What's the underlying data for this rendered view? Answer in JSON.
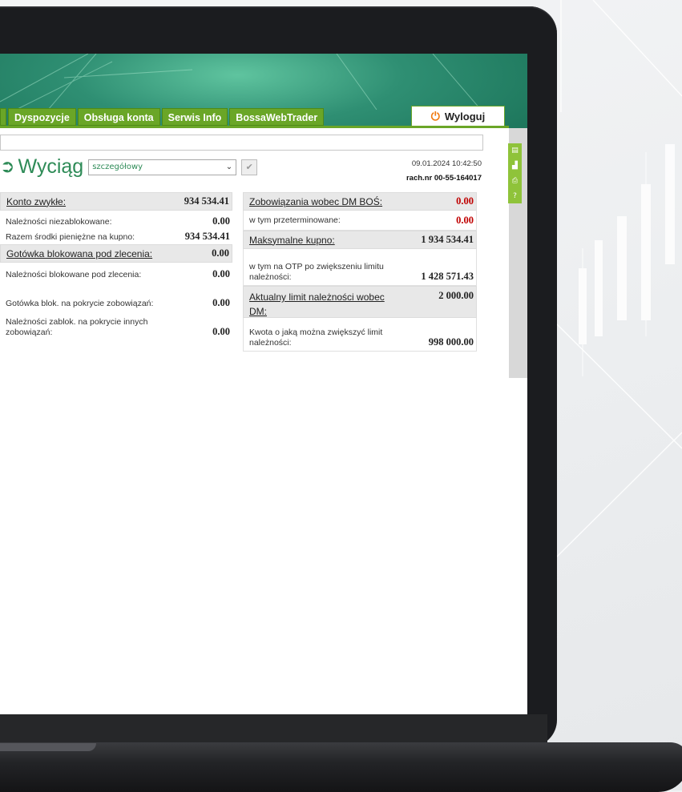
{
  "nav": {
    "tabs": [
      "Dyspozycje",
      "Obsługa konta",
      "Serwis Info",
      "BossaWebTrader"
    ],
    "logout_label": "Wyloguj"
  },
  "statement": {
    "title": "Wyciąg",
    "view_select": "szczegółowy",
    "datetime": "09.01.2024 10:42:50",
    "account": "rach.nr 00-55-164017"
  },
  "left": {
    "konto_label": "Konto zwykłe:",
    "konto_value": "934 534.41",
    "nal_niezab_label": "Należności niezablokowane:",
    "nal_niezab_value": "0.00",
    "razem_label": "Razem środki pieniężne na kupno:",
    "razem_value": "934 534.41",
    "gotowka_label": "Gotówka blokowana pod zlecenia:",
    "gotowka_value": "0.00",
    "nal_blok_label": "Należności blokowane pod zlecenia:",
    "nal_blok_value": "0.00",
    "got_blok_label": "Gotówka blok. na pokrycie zobowiązań:",
    "got_blok_value": "0.00",
    "nal_zablok_label": "Należności zablok. na pokrycie innych zobowiązań:",
    "nal_zablok_value": "0.00"
  },
  "right": {
    "zobow_label": "Zobowiązania wobec DM BOŚ:",
    "zobow_value": "0.00",
    "przeterm_label": "w tym przeterminowane:",
    "przeterm_value": "0.00",
    "maks_label": "Maksymalne kupno:",
    "maks_value": "1 934 534.41",
    "otp_label": "w tym na OTP po zwiększeniu limitu należności:",
    "otp_value": "1 428 571.43",
    "limit_label": "Aktualny limit należności wobec DM:",
    "limit_value": "2 000.00",
    "kwota_label": "Kwota o jaką można zwiększyć limit należności:",
    "kwota_value": "998 000.00"
  },
  "colors": {
    "tab_green": "#6aa627",
    "title_green": "#2e8b57",
    "negative_red": "#c00000"
  }
}
